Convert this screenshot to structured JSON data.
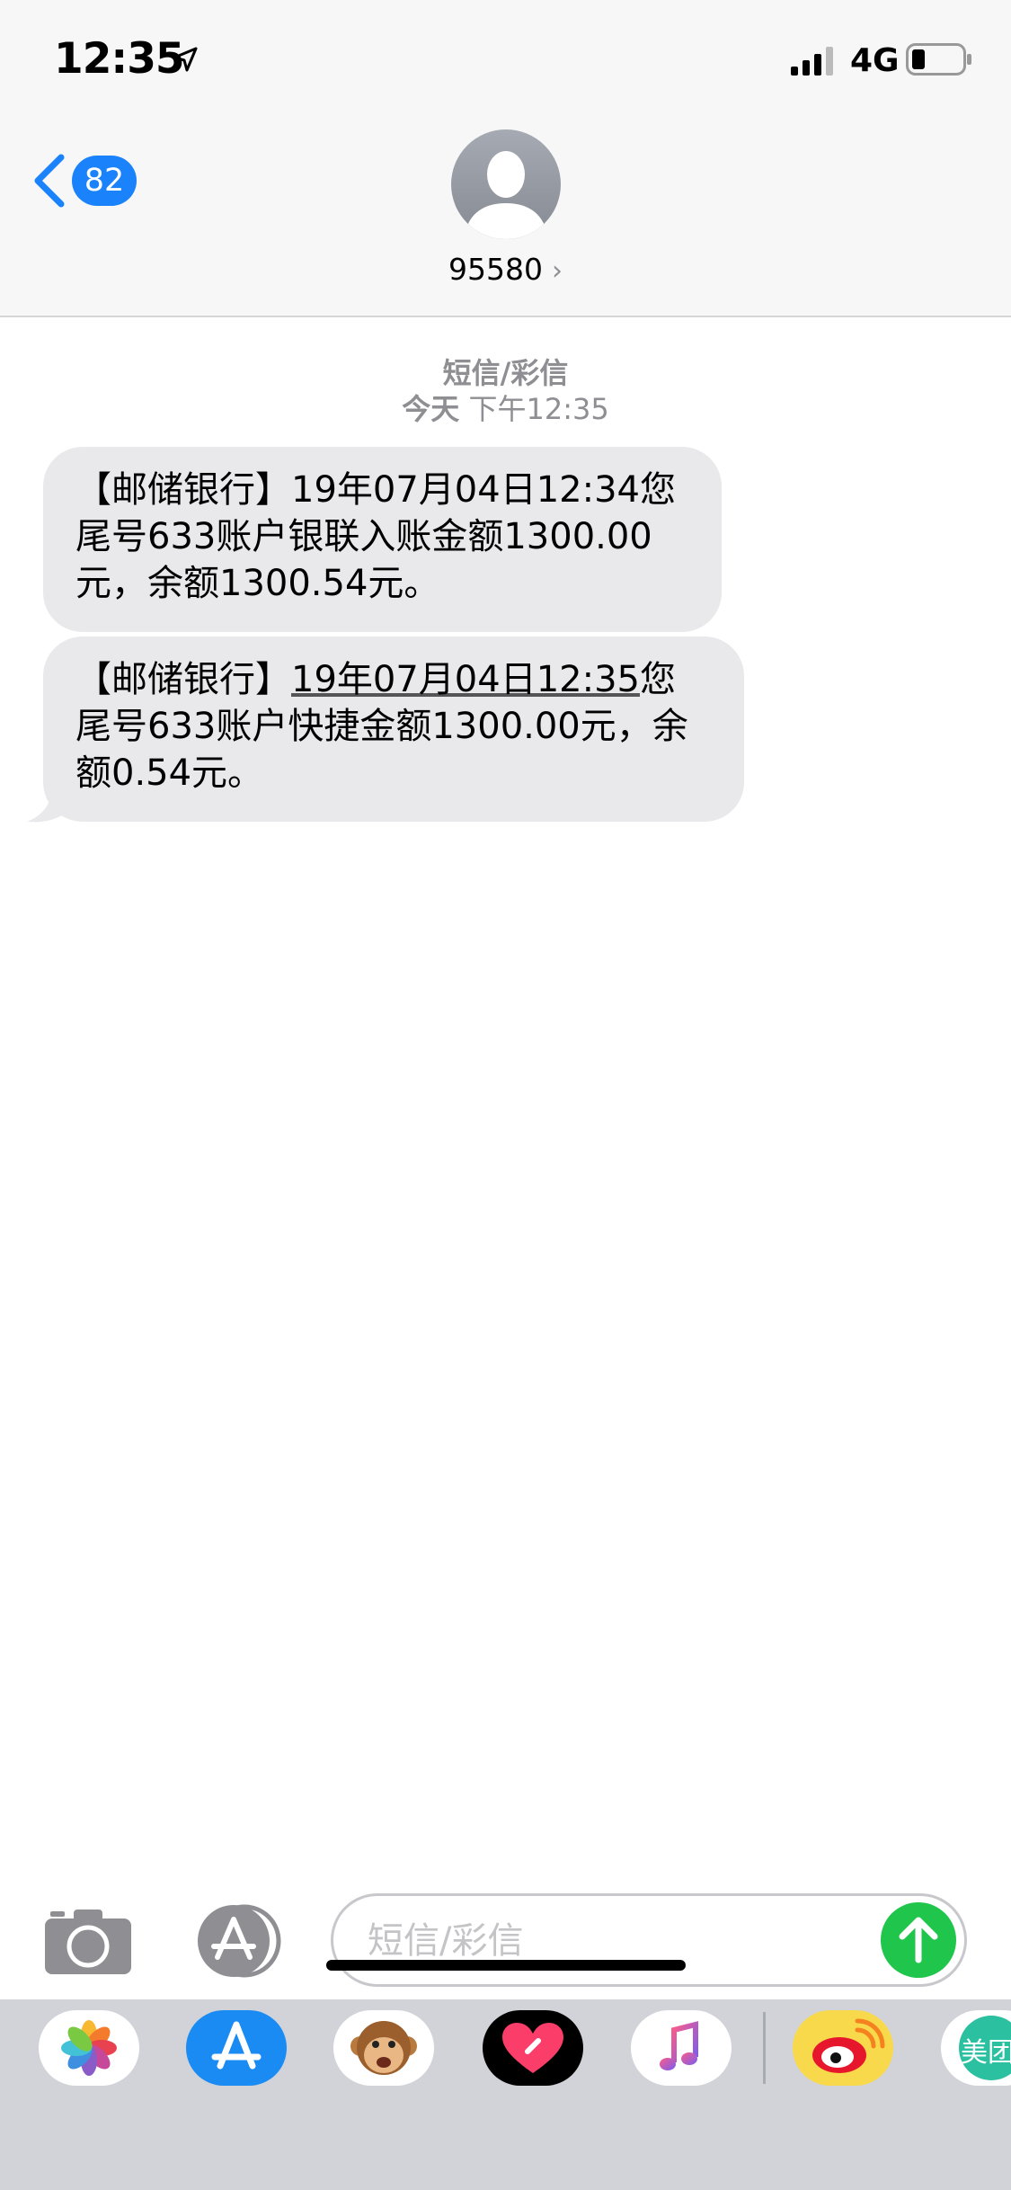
{
  "status_bar": {
    "time": "12:35",
    "network": "4G"
  },
  "nav": {
    "badge_count": "82",
    "contact_name": "95580",
    "contact_chevron": "›"
  },
  "conversation": {
    "service_label": "短信/彩信",
    "timestamp_day": "今天",
    "timestamp_time": "下午12:35",
    "messages": [
      {
        "prefix": "【邮储银行】",
        "date_part": "19年07月04日12:34",
        "rest_line1": "您",
        "line2": "尾号633账户银联入账金额1300.00",
        "line3": "元，余额1300.54元。"
      },
      {
        "prefix": "【邮储银行】",
        "date_part": "19年07月04日12:35",
        "rest_line1": "您",
        "line2": "尾号633账户快捷金额1300.00元，余",
        "line3": "额0.54元。"
      }
    ]
  },
  "compose": {
    "placeholder": "短信/彩信",
    "value": ""
  },
  "app_drawer": {
    "apps": [
      "photos-icon",
      "app-store-icon",
      "animoji-icon",
      "digital-touch-icon",
      "music-icon",
      "weibo-icon",
      "meituan-icon"
    ],
    "meituan_label": "美团"
  },
  "colors": {
    "accent": "#1a82fb",
    "send": "#1fc64b",
    "bubble": "#e9e9eb",
    "secondary_text": "#8e8e93"
  }
}
